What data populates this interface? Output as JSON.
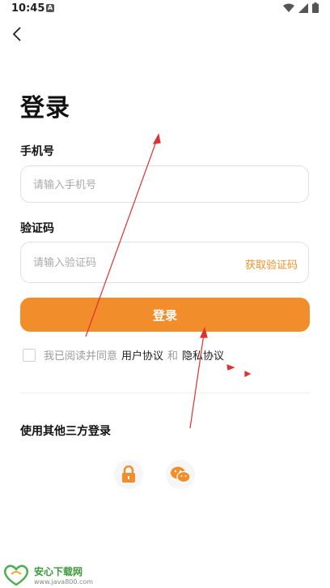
{
  "status_bar": {
    "time": "10:45",
    "notification_icon": "A"
  },
  "page": {
    "title": "登录"
  },
  "phone": {
    "label": "手机号",
    "placeholder": "请输入手机号"
  },
  "code": {
    "label": "验证码",
    "placeholder": "请输入验证码",
    "get_code": "获取验证码"
  },
  "login_button": "登录",
  "agreement": {
    "prefix": "我已阅读并同意",
    "user_agreement": "用户协议",
    "and": "和",
    "privacy": "隐私协议"
  },
  "other_login": {
    "title": "使用其他三方登录",
    "icons": [
      "lock-icon",
      "wechat-icon"
    ]
  },
  "watermark": {
    "name": "安心下载网",
    "url": "www.java800.com"
  },
  "colors": {
    "accent": "#f28d2b",
    "annotation": "#e03030"
  }
}
